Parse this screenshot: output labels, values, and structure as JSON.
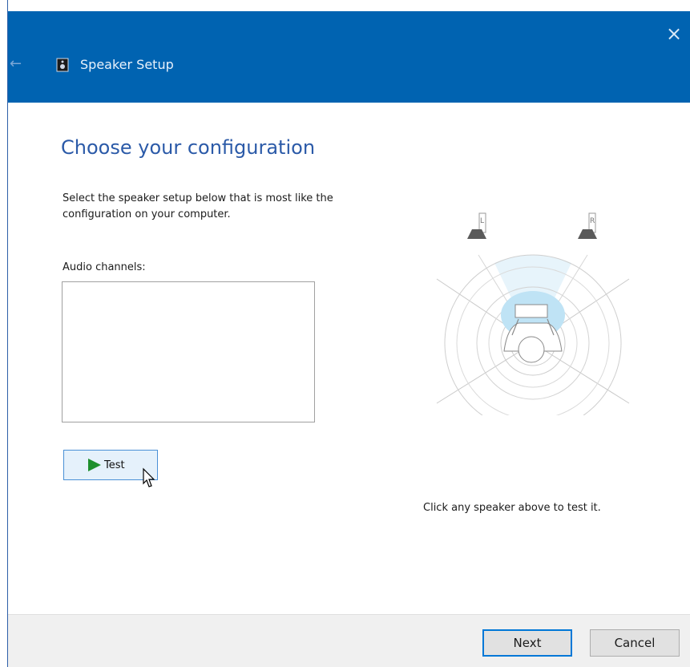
{
  "window": {
    "title": "Speaker Setup",
    "close_glyph": "×",
    "back_glyph": "←",
    "accent": "#0063b1"
  },
  "main": {
    "heading": "Choose your configuration",
    "description": "Select the speaker setup below that is most like the configuration on your computer.",
    "audio_channels_label": "Audio channels:",
    "test_button_label": "Test",
    "hint": "Click any speaker above to test it.",
    "speaker_labels": {
      "left": "L",
      "right": "R"
    }
  },
  "footer": {
    "next_label": "Next",
    "cancel_label": "Cancel"
  }
}
